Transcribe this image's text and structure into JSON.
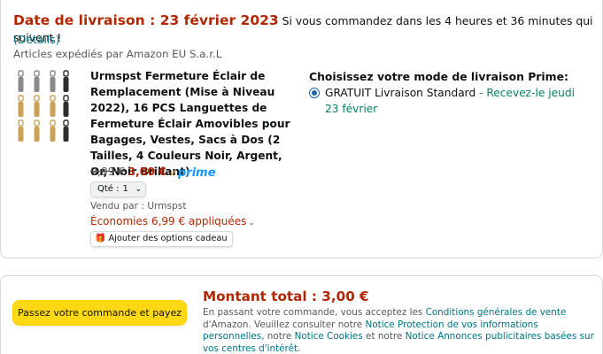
{
  "delivery": {
    "label": "Date de livraison",
    "date": "23 février 2023",
    "note": "Si vous commandez dans les 4 heures et 36 minutes qui suivent !",
    "details_link": "(Détails)",
    "shipped_by": "Articles expédiés par Amazon EU S.a.r.L"
  },
  "product": {
    "title": "Urmspst Fermeture Éclair de Remplacement (Mise à Niveau 2022), 16 PCS Languettes de Fermeture Éclair Amovibles pour Bagages, Vestes, Sacs à Dos (2 Tailles, 4 Couleurs Noir, Argent, Or, Noir Brillant)",
    "old_price": "9,99 €",
    "price": "3,00 €",
    "prime_check": "✓",
    "prime_label": "prime",
    "qty_label": "Qté :",
    "qty_value": "1",
    "sold_by": "Vendu par : Urmspst",
    "savings": "Économies 6,99 € appliquées",
    "gift_button": "Ajouter des options cadeau",
    "swatch_colors": [
      "#8a8a8a",
      "#c9a25a",
      "#2e2e2e"
    ]
  },
  "shipping": {
    "title": "Choisissez votre mode de livraison Prime:",
    "option_free": "GRATUIT Livraison Standard",
    "option_separator": " - ",
    "option_date": "Recevez-le jeudi 23 février"
  },
  "checkout": {
    "place_order": "Passez votre commande et payez",
    "total_label": "Montant total : 3,00 €",
    "legal": {
      "t1": "En passant votre commande, vous acceptez les ",
      "l1": "Conditions générales de vente",
      "t2": " d'Amazon. Veuillez consulter notre ",
      "l2": "Notice Protection de vos informations personnelles",
      "t3": ", notre ",
      "l3": "Notice Cookies",
      "t4": " et notre ",
      "l4": "Notice Annonces publicitaires basées sur vos centres d'intérêt",
      "t5": "."
    }
  }
}
